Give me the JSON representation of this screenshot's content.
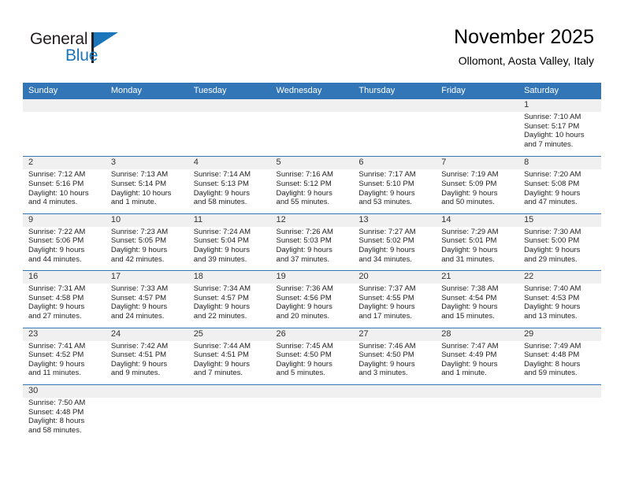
{
  "logo": {
    "word_top": "General",
    "word_bottom": "Blue",
    "accent_color": "#1b75bb"
  },
  "header": {
    "title": "November 2025",
    "subtitle": "Ollomont, Aosta Valley, Italy"
  },
  "theme": {
    "header_bg": "#3276b8",
    "date_band_bg": "#f0f0f0",
    "row_divider": "#3276b8"
  },
  "day_names": [
    "Sunday",
    "Monday",
    "Tuesday",
    "Wednesday",
    "Thursday",
    "Friday",
    "Saturday"
  ],
  "weeks": [
    [
      {
        "day": "",
        "lines": []
      },
      {
        "day": "",
        "lines": []
      },
      {
        "day": "",
        "lines": []
      },
      {
        "day": "",
        "lines": []
      },
      {
        "day": "",
        "lines": []
      },
      {
        "day": "",
        "lines": []
      },
      {
        "day": "1",
        "lines": [
          "Sunrise: 7:10 AM",
          "Sunset: 5:17 PM",
          "Daylight: 10 hours",
          "and 7 minutes."
        ]
      }
    ],
    [
      {
        "day": "2",
        "lines": [
          "Sunrise: 7:12 AM",
          "Sunset: 5:16 PM",
          "Daylight: 10 hours",
          "and 4 minutes."
        ]
      },
      {
        "day": "3",
        "lines": [
          "Sunrise: 7:13 AM",
          "Sunset: 5:14 PM",
          "Daylight: 10 hours",
          "and 1 minute."
        ]
      },
      {
        "day": "4",
        "lines": [
          "Sunrise: 7:14 AM",
          "Sunset: 5:13 PM",
          "Daylight: 9 hours",
          "and 58 minutes."
        ]
      },
      {
        "day": "5",
        "lines": [
          "Sunrise: 7:16 AM",
          "Sunset: 5:12 PM",
          "Daylight: 9 hours",
          "and 55 minutes."
        ]
      },
      {
        "day": "6",
        "lines": [
          "Sunrise: 7:17 AM",
          "Sunset: 5:10 PM",
          "Daylight: 9 hours",
          "and 53 minutes."
        ]
      },
      {
        "day": "7",
        "lines": [
          "Sunrise: 7:19 AM",
          "Sunset: 5:09 PM",
          "Daylight: 9 hours",
          "and 50 minutes."
        ]
      },
      {
        "day": "8",
        "lines": [
          "Sunrise: 7:20 AM",
          "Sunset: 5:08 PM",
          "Daylight: 9 hours",
          "and 47 minutes."
        ]
      }
    ],
    [
      {
        "day": "9",
        "lines": [
          "Sunrise: 7:22 AM",
          "Sunset: 5:06 PM",
          "Daylight: 9 hours",
          "and 44 minutes."
        ]
      },
      {
        "day": "10",
        "lines": [
          "Sunrise: 7:23 AM",
          "Sunset: 5:05 PM",
          "Daylight: 9 hours",
          "and 42 minutes."
        ]
      },
      {
        "day": "11",
        "lines": [
          "Sunrise: 7:24 AM",
          "Sunset: 5:04 PM",
          "Daylight: 9 hours",
          "and 39 minutes."
        ]
      },
      {
        "day": "12",
        "lines": [
          "Sunrise: 7:26 AM",
          "Sunset: 5:03 PM",
          "Daylight: 9 hours",
          "and 37 minutes."
        ]
      },
      {
        "day": "13",
        "lines": [
          "Sunrise: 7:27 AM",
          "Sunset: 5:02 PM",
          "Daylight: 9 hours",
          "and 34 minutes."
        ]
      },
      {
        "day": "14",
        "lines": [
          "Sunrise: 7:29 AM",
          "Sunset: 5:01 PM",
          "Daylight: 9 hours",
          "and 31 minutes."
        ]
      },
      {
        "day": "15",
        "lines": [
          "Sunrise: 7:30 AM",
          "Sunset: 5:00 PM",
          "Daylight: 9 hours",
          "and 29 minutes."
        ]
      }
    ],
    [
      {
        "day": "16",
        "lines": [
          "Sunrise: 7:31 AM",
          "Sunset: 4:58 PM",
          "Daylight: 9 hours",
          "and 27 minutes."
        ]
      },
      {
        "day": "17",
        "lines": [
          "Sunrise: 7:33 AM",
          "Sunset: 4:57 PM",
          "Daylight: 9 hours",
          "and 24 minutes."
        ]
      },
      {
        "day": "18",
        "lines": [
          "Sunrise: 7:34 AM",
          "Sunset: 4:57 PM",
          "Daylight: 9 hours",
          "and 22 minutes."
        ]
      },
      {
        "day": "19",
        "lines": [
          "Sunrise: 7:36 AM",
          "Sunset: 4:56 PM",
          "Daylight: 9 hours",
          "and 20 minutes."
        ]
      },
      {
        "day": "20",
        "lines": [
          "Sunrise: 7:37 AM",
          "Sunset: 4:55 PM",
          "Daylight: 9 hours",
          "and 17 minutes."
        ]
      },
      {
        "day": "21",
        "lines": [
          "Sunrise: 7:38 AM",
          "Sunset: 4:54 PM",
          "Daylight: 9 hours",
          "and 15 minutes."
        ]
      },
      {
        "day": "22",
        "lines": [
          "Sunrise: 7:40 AM",
          "Sunset: 4:53 PM",
          "Daylight: 9 hours",
          "and 13 minutes."
        ]
      }
    ],
    [
      {
        "day": "23",
        "lines": [
          "Sunrise: 7:41 AM",
          "Sunset: 4:52 PM",
          "Daylight: 9 hours",
          "and 11 minutes."
        ]
      },
      {
        "day": "24",
        "lines": [
          "Sunrise: 7:42 AM",
          "Sunset: 4:51 PM",
          "Daylight: 9 hours",
          "and 9 minutes."
        ]
      },
      {
        "day": "25",
        "lines": [
          "Sunrise: 7:44 AM",
          "Sunset: 4:51 PM",
          "Daylight: 9 hours",
          "and 7 minutes."
        ]
      },
      {
        "day": "26",
        "lines": [
          "Sunrise: 7:45 AM",
          "Sunset: 4:50 PM",
          "Daylight: 9 hours",
          "and 5 minutes."
        ]
      },
      {
        "day": "27",
        "lines": [
          "Sunrise: 7:46 AM",
          "Sunset: 4:50 PM",
          "Daylight: 9 hours",
          "and 3 minutes."
        ]
      },
      {
        "day": "28",
        "lines": [
          "Sunrise: 7:47 AM",
          "Sunset: 4:49 PM",
          "Daylight: 9 hours",
          "and 1 minute."
        ]
      },
      {
        "day": "29",
        "lines": [
          "Sunrise: 7:49 AM",
          "Sunset: 4:48 PM",
          "Daylight: 8 hours",
          "and 59 minutes."
        ]
      }
    ],
    [
      {
        "day": "30",
        "lines": [
          "Sunrise: 7:50 AM",
          "Sunset: 4:48 PM",
          "Daylight: 8 hours",
          "and 58 minutes."
        ]
      },
      {
        "day": "",
        "lines": []
      },
      {
        "day": "",
        "lines": []
      },
      {
        "day": "",
        "lines": []
      },
      {
        "day": "",
        "lines": []
      },
      {
        "day": "",
        "lines": []
      },
      {
        "day": "",
        "lines": []
      }
    ]
  ]
}
